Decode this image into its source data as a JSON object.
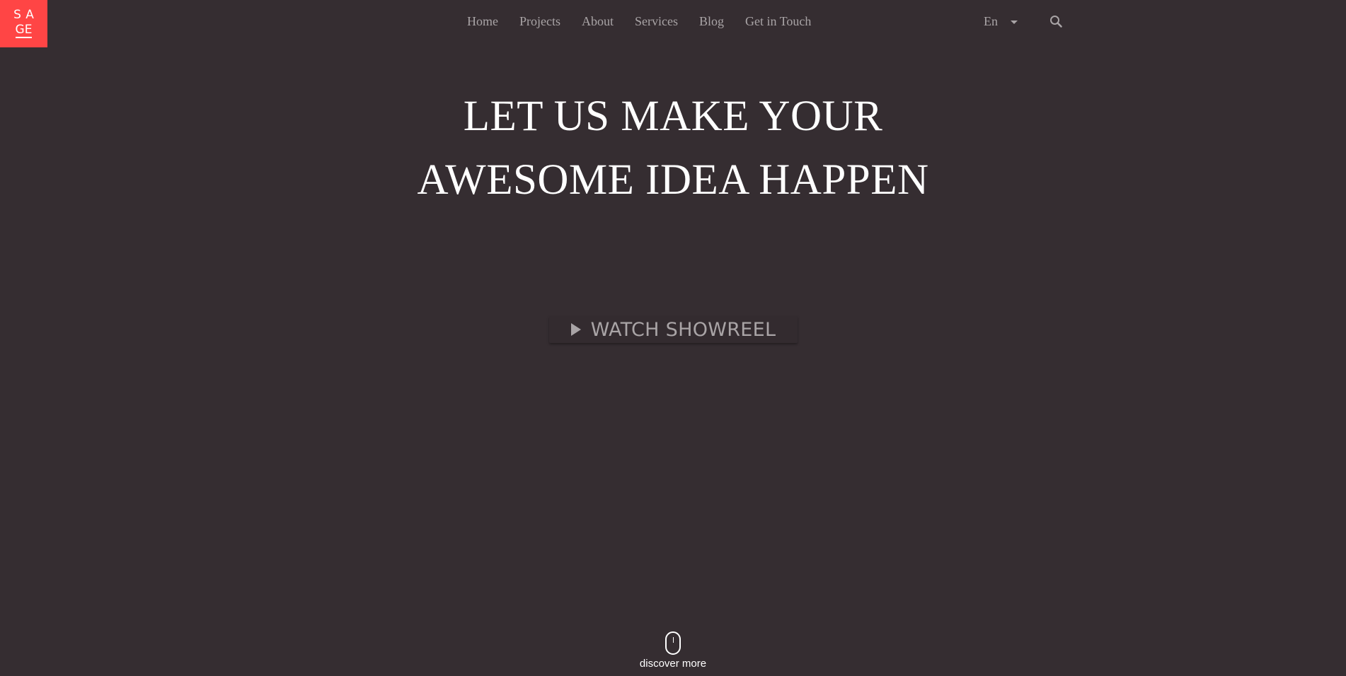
{
  "brand": {
    "logo_top": "SA",
    "logo_bottom": "GE",
    "logo_bg": "#ff4545"
  },
  "nav": {
    "items": [
      {
        "label": "Home"
      },
      {
        "label": "Projects"
      },
      {
        "label": "About"
      },
      {
        "label": "Services"
      },
      {
        "label": "Blog"
      },
      {
        "label": "Get in Touch"
      }
    ]
  },
  "language": {
    "selected": "En"
  },
  "icons": {
    "search": "search-icon",
    "language_caret": "chevron-down-icon",
    "play": "play-icon",
    "mouse": "mouse-icon"
  },
  "hero": {
    "line1": "LET US MAKE YOUR",
    "line2": "AWESOME IDEA HAPPEN"
  },
  "showreel": {
    "label": "WATCH SHOWREEL"
  },
  "discover": {
    "label": "discover more"
  },
  "colors": {
    "background": "#352d31",
    "muted_text": "#a9a4a6",
    "accent": "#ff4545"
  }
}
